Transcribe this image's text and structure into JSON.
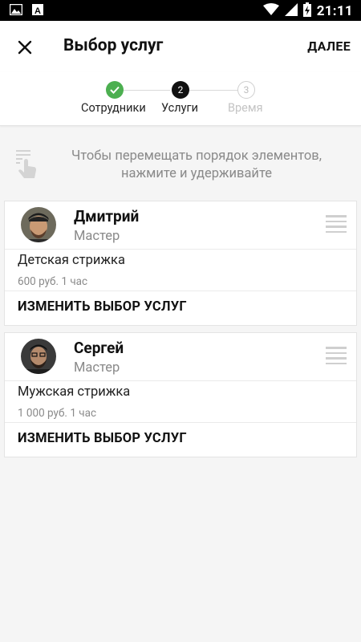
{
  "status_bar": {
    "time": "21:11",
    "left_icons": [
      "image-icon",
      "font-icon"
    ],
    "right_icons": [
      "wifi-icon",
      "signal-icon",
      "battery-icon"
    ]
  },
  "toolbar": {
    "title": "Выбор услуг",
    "next_label": "ДАЛЕЕ",
    "close_icon": "close-icon"
  },
  "stepper": {
    "steps": [
      {
        "label": "Сотрудники",
        "state": "done",
        "number": ""
      },
      {
        "label": "Услуги",
        "state": "active",
        "number": "2"
      },
      {
        "label": "Время",
        "state": "todo",
        "number": "3"
      }
    ],
    "colors": {
      "done": "#4caf50",
      "active": "#111111",
      "todo": "#cfcfcf"
    }
  },
  "hint": {
    "icon": "tap-hold-icon",
    "text": "Чтобы перемещать порядок элементов, нажмите и удерживайте"
  },
  "cards": [
    {
      "name": "Дмитрий",
      "role": "Мастер",
      "service": "Детская стрижка",
      "meta": "600 руб.  1 час",
      "action": "ИЗМЕНИТЬ ВЫБОР УСЛУГ"
    },
    {
      "name": "Сергей",
      "role": "Мастер",
      "service": "Мужская стрижка",
      "meta": "1 000 руб.  1 час",
      "action": "ИЗМЕНИТЬ ВЫБОР УСЛУГ"
    }
  ]
}
